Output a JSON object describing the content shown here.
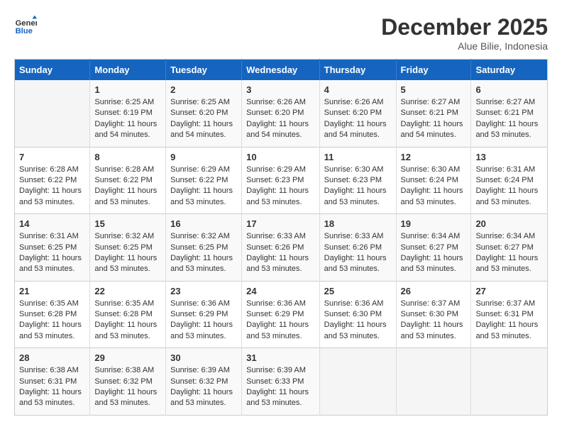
{
  "logo": {
    "line1": "General",
    "line2": "Blue"
  },
  "title": "December 2025",
  "location": "Alue Bilie, Indonesia",
  "days_of_week": [
    "Sunday",
    "Monday",
    "Tuesday",
    "Wednesday",
    "Thursday",
    "Friday",
    "Saturday"
  ],
  "weeks": [
    [
      {
        "day": "",
        "info": ""
      },
      {
        "day": "1",
        "info": "Sunrise: 6:25 AM\nSunset: 6:19 PM\nDaylight: 11 hours and 54 minutes."
      },
      {
        "day": "2",
        "info": "Sunrise: 6:25 AM\nSunset: 6:20 PM\nDaylight: 11 hours and 54 minutes."
      },
      {
        "day": "3",
        "info": "Sunrise: 6:26 AM\nSunset: 6:20 PM\nDaylight: 11 hours and 54 minutes."
      },
      {
        "day": "4",
        "info": "Sunrise: 6:26 AM\nSunset: 6:20 PM\nDaylight: 11 hours and 54 minutes."
      },
      {
        "day": "5",
        "info": "Sunrise: 6:27 AM\nSunset: 6:21 PM\nDaylight: 11 hours and 54 minutes."
      },
      {
        "day": "6",
        "info": "Sunrise: 6:27 AM\nSunset: 6:21 PM\nDaylight: 11 hours and 53 minutes."
      }
    ],
    [
      {
        "day": "7",
        "info": "Sunrise: 6:28 AM\nSunset: 6:22 PM\nDaylight: 11 hours and 53 minutes."
      },
      {
        "day": "8",
        "info": "Sunrise: 6:28 AM\nSunset: 6:22 PM\nDaylight: 11 hours and 53 minutes."
      },
      {
        "day": "9",
        "info": "Sunrise: 6:29 AM\nSunset: 6:22 PM\nDaylight: 11 hours and 53 minutes."
      },
      {
        "day": "10",
        "info": "Sunrise: 6:29 AM\nSunset: 6:23 PM\nDaylight: 11 hours and 53 minutes."
      },
      {
        "day": "11",
        "info": "Sunrise: 6:30 AM\nSunset: 6:23 PM\nDaylight: 11 hours and 53 minutes."
      },
      {
        "day": "12",
        "info": "Sunrise: 6:30 AM\nSunset: 6:24 PM\nDaylight: 11 hours and 53 minutes."
      },
      {
        "day": "13",
        "info": "Sunrise: 6:31 AM\nSunset: 6:24 PM\nDaylight: 11 hours and 53 minutes."
      }
    ],
    [
      {
        "day": "14",
        "info": "Sunrise: 6:31 AM\nSunset: 6:25 PM\nDaylight: 11 hours and 53 minutes."
      },
      {
        "day": "15",
        "info": "Sunrise: 6:32 AM\nSunset: 6:25 PM\nDaylight: 11 hours and 53 minutes."
      },
      {
        "day": "16",
        "info": "Sunrise: 6:32 AM\nSunset: 6:25 PM\nDaylight: 11 hours and 53 minutes."
      },
      {
        "day": "17",
        "info": "Sunrise: 6:33 AM\nSunset: 6:26 PM\nDaylight: 11 hours and 53 minutes."
      },
      {
        "day": "18",
        "info": "Sunrise: 6:33 AM\nSunset: 6:26 PM\nDaylight: 11 hours and 53 minutes."
      },
      {
        "day": "19",
        "info": "Sunrise: 6:34 AM\nSunset: 6:27 PM\nDaylight: 11 hours and 53 minutes."
      },
      {
        "day": "20",
        "info": "Sunrise: 6:34 AM\nSunset: 6:27 PM\nDaylight: 11 hours and 53 minutes."
      }
    ],
    [
      {
        "day": "21",
        "info": "Sunrise: 6:35 AM\nSunset: 6:28 PM\nDaylight: 11 hours and 53 minutes."
      },
      {
        "day": "22",
        "info": "Sunrise: 6:35 AM\nSunset: 6:28 PM\nDaylight: 11 hours and 53 minutes."
      },
      {
        "day": "23",
        "info": "Sunrise: 6:36 AM\nSunset: 6:29 PM\nDaylight: 11 hours and 53 minutes."
      },
      {
        "day": "24",
        "info": "Sunrise: 6:36 AM\nSunset: 6:29 PM\nDaylight: 11 hours and 53 minutes."
      },
      {
        "day": "25",
        "info": "Sunrise: 6:36 AM\nSunset: 6:30 PM\nDaylight: 11 hours and 53 minutes."
      },
      {
        "day": "26",
        "info": "Sunrise: 6:37 AM\nSunset: 6:30 PM\nDaylight: 11 hours and 53 minutes."
      },
      {
        "day": "27",
        "info": "Sunrise: 6:37 AM\nSunset: 6:31 PM\nDaylight: 11 hours and 53 minutes."
      }
    ],
    [
      {
        "day": "28",
        "info": "Sunrise: 6:38 AM\nSunset: 6:31 PM\nDaylight: 11 hours and 53 minutes."
      },
      {
        "day": "29",
        "info": "Sunrise: 6:38 AM\nSunset: 6:32 PM\nDaylight: 11 hours and 53 minutes."
      },
      {
        "day": "30",
        "info": "Sunrise: 6:39 AM\nSunset: 6:32 PM\nDaylight: 11 hours and 53 minutes."
      },
      {
        "day": "31",
        "info": "Sunrise: 6:39 AM\nSunset: 6:33 PM\nDaylight: 11 hours and 53 minutes."
      },
      {
        "day": "",
        "info": ""
      },
      {
        "day": "",
        "info": ""
      },
      {
        "day": "",
        "info": ""
      }
    ]
  ]
}
